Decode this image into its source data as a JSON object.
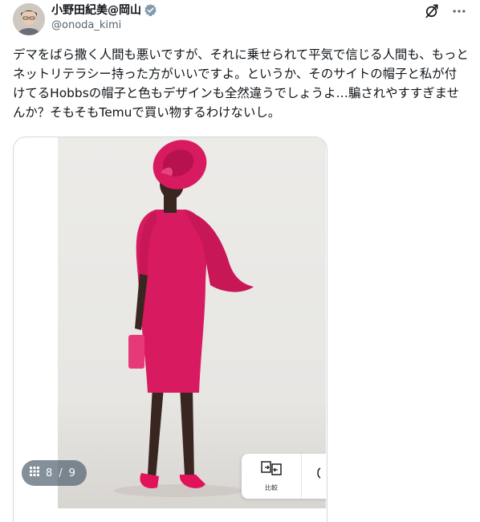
{
  "author": {
    "display_name": "小野田紀美@岡山",
    "handle": "@onoda_kimi",
    "verified": true
  },
  "icons": {
    "verified": "verified-badge-icon",
    "grok": "grok-icon",
    "more": "more-options-icon",
    "gallery": "gallery-grid-icon",
    "compare": "compare-icon"
  },
  "colors": {
    "text": "#0f1419",
    "secondary_text": "#536471",
    "verified_badge": "#829aab",
    "dress": "#d81b60",
    "card_border": "#cfd9de"
  },
  "post": {
    "text": "デマをばら撒く人間も悪いですが、それに乗せられて平気で信じる人間も、もっとネットリテラシー持った方がいいですよ。というか、そのサイトの帽子と私が付けてるHobbsの帽子と色もデザインも全然違うでしょうよ…騙されやすすぎませんか？そもそもTemuで買い物するわけないし。"
  },
  "media": {
    "image_alt": "Woman in a pink dress and pink hat",
    "counter": {
      "current": "8",
      "separator": "/",
      "total": "9"
    },
    "compare_label": "比較"
  }
}
